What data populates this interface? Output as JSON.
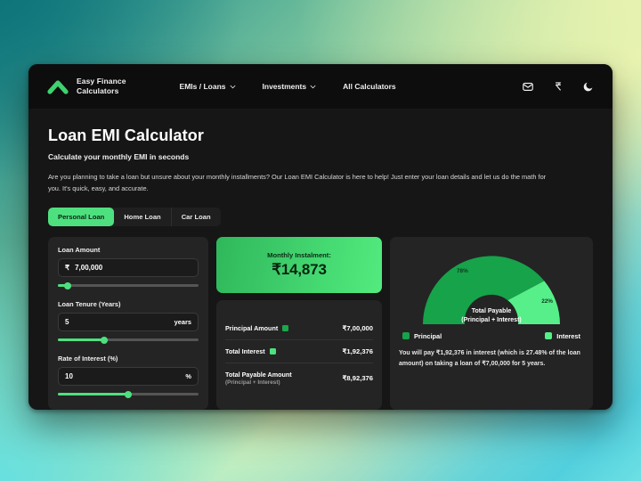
{
  "brand": {
    "line1": "Easy Finance",
    "line2": "Calculators",
    "logo_icon": "chevron-up-logo-icon"
  },
  "nav": {
    "links": [
      {
        "label": "EMIs / Loans",
        "caret": "chevron-down-icon"
      },
      {
        "label": "Investments",
        "caret": "chevron-down-icon"
      },
      {
        "label": "All Calculators",
        "caret": ""
      }
    ],
    "icons": [
      {
        "name": "mail-icon"
      },
      {
        "name": "currency-rupee-icon"
      },
      {
        "name": "moon-dark-mode-icon"
      }
    ]
  },
  "page": {
    "title": "Loan EMI Calculator",
    "subtitle": "Calculate your monthly EMI in seconds",
    "description": "Are you planning to take a loan but unsure about your monthly installments? Our Loan EMI Calculator is here to help! Just enter your loan details and let us do the math for you. It's quick, easy, and accurate."
  },
  "tabs": [
    {
      "label": "Personal Loan",
      "active": true
    },
    {
      "label": "Home Loan",
      "active": false
    },
    {
      "label": "Car Loan",
      "active": false
    }
  ],
  "inputs": {
    "loan_amount": {
      "label": "Loan Amount",
      "prefix": "₹",
      "value": "7,00,000",
      "suffix": "",
      "slider_pct": 7
    },
    "loan_tenure": {
      "label": "Loan Tenure (Years)",
      "prefix": "",
      "value": "5",
      "suffix": "years",
      "slider_pct": 33
    },
    "rate_of_interest": {
      "label": "Rate of Interest (%)",
      "prefix": "",
      "value": "10",
      "suffix": "%",
      "slider_pct": 50
    }
  },
  "emi_card": {
    "label": "Monthly Instalment:",
    "value": "₹14,873"
  },
  "breakdown": [
    {
      "label": "Principal Amount",
      "sub": "",
      "value": "₹7,00,000",
      "swatch": "#19a84a"
    },
    {
      "label": "Total Interest",
      "sub": "",
      "value": "₹1,92,376",
      "swatch": "#4ee07f"
    },
    {
      "label": "Total Payable Amount",
      "sub": "(Principal + Interest)",
      "value": "₹8,92,376",
      "swatch": ""
    }
  ],
  "colors": {
    "principal": "#16a34a",
    "interest": "#56ef89",
    "accent": "#4ee07f",
    "panel": "#242424"
  },
  "chart_data": {
    "type": "pie",
    "subtype": "half-donut-gauge",
    "title": "Total Payable",
    "subtitle": "(Principal + Interest)",
    "categories": [
      "Principal",
      "Interest"
    ],
    "values": [
      78,
      22
    ],
    "value_labels": [
      "78%",
      "22%"
    ],
    "colors": [
      "#16a34a",
      "#56ef89"
    ],
    "legend": [
      "Principal",
      "Interest"
    ],
    "legend_position": "bottom"
  },
  "note": "You will pay ₹1,92,376 in interest (which is 27.48% of the loan amount) on taking a loan of ₹7,00,000 for 5 years."
}
